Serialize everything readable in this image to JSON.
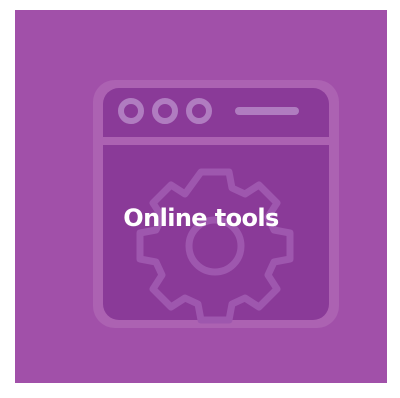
{
  "tile": {
    "title": "Online tools",
    "icon": "browser-window-gear-icon",
    "colors": {
      "background": "#a150a9",
      "icon_frame": "#ac62b2",
      "window_fill": "#8a3a98",
      "window_dots": "#a96dba",
      "gear": "#9a4fab",
      "title_text": "#ffffff"
    }
  }
}
